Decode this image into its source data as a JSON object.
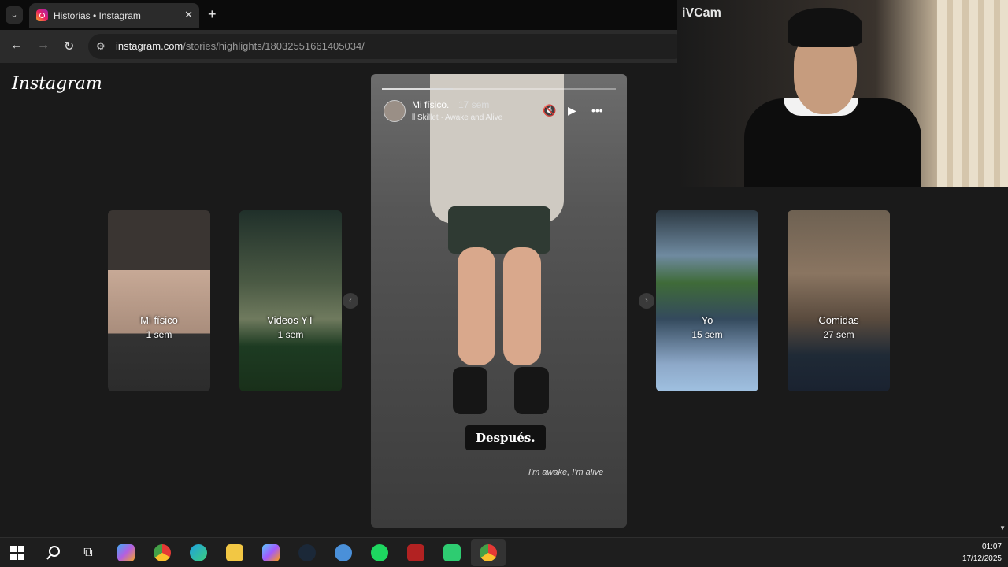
{
  "browser": {
    "tab_title": "Historias • Instagram",
    "new_tab": "+",
    "url_domain": "instagram.com",
    "url_path": "/stories/highlights/18032551661405034/"
  },
  "instagram": {
    "logo": "Instagram",
    "highlights": [
      {
        "name": "Mi físico",
        "age": "1 sem"
      },
      {
        "name": "Videos YT",
        "age": "1 sem"
      },
      {
        "name": "Yo",
        "age": "15 sem"
      },
      {
        "name": "Comidas",
        "age": "27 sem"
      }
    ],
    "story": {
      "username": "Mi físico.",
      "age": "17 sem",
      "music": "Skillet · Awake and Alive",
      "caption": "Después.",
      "lyric": "I'm awake, I'm alive"
    }
  },
  "webcam": {
    "label": "iVCam"
  },
  "taskbar": {
    "time": "01:07",
    "date": "17/12/2025",
    "icons": [
      "windows-start-icon",
      "search-icon",
      "task-view-icon",
      "copilot-icon",
      "chrome-icon",
      "edge-icon",
      "file-explorer-icon",
      "copilot-365-icon",
      "steam-icon",
      "app-icon",
      "spotify-icon",
      "app-red-icon",
      "app-green-icon",
      "chrome-active-icon"
    ]
  },
  "colors": {
    "page_bg": "#1a1a1a",
    "tab_bg": "#2b2b2b",
    "taskbar_bg": "#1e1e1e"
  }
}
